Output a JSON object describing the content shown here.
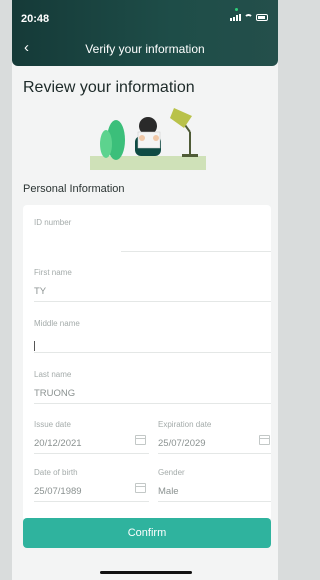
{
  "status": {
    "time": "20:48"
  },
  "header": {
    "title": "Verify your information",
    "back_icon": "chevron-left-icon"
  },
  "page": {
    "heading": "Review your information",
    "section": "Personal Information"
  },
  "fields": {
    "id_number": {
      "label": "ID number",
      "value": ""
    },
    "first_name": {
      "label": "First name",
      "value": "TY"
    },
    "middle_name": {
      "label": "Middle name",
      "value": ""
    },
    "last_name": {
      "label": "Last name",
      "value": "TRUONG"
    },
    "issue_date": {
      "label": "Issue date",
      "value": "20/12/2021"
    },
    "expiration_date": {
      "label": "Expiration date",
      "value": "25/07/2029"
    },
    "date_of_birth": {
      "label": "Date of birth",
      "value": "25/07/1989"
    },
    "gender": {
      "label": "Gender",
      "value": "Male"
    }
  },
  "actions": {
    "confirm": "Confirm"
  },
  "colors": {
    "header": "#1e4d48",
    "accent": "#2fb39e"
  }
}
